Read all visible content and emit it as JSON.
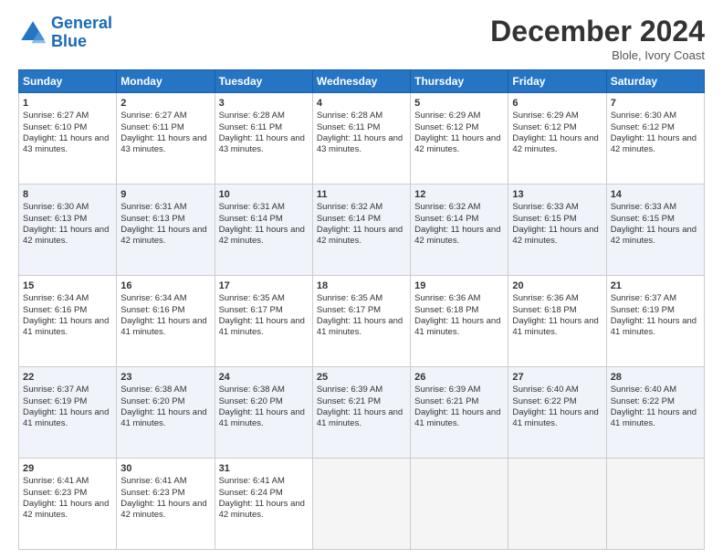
{
  "header": {
    "logo_line1": "General",
    "logo_line2": "Blue",
    "month_title": "December 2024",
    "location": "Blole, Ivory Coast"
  },
  "days_of_week": [
    "Sunday",
    "Monday",
    "Tuesday",
    "Wednesday",
    "Thursday",
    "Friday",
    "Saturday"
  ],
  "weeks": [
    [
      {
        "day": "1",
        "rise": "6:27 AM",
        "set": "6:10 PM",
        "daylight": "11 hours and 43 minutes."
      },
      {
        "day": "2",
        "rise": "6:27 AM",
        "set": "6:11 PM",
        "daylight": "11 hours and 43 minutes."
      },
      {
        "day": "3",
        "rise": "6:28 AM",
        "set": "6:11 PM",
        "daylight": "11 hours and 43 minutes."
      },
      {
        "day": "4",
        "rise": "6:28 AM",
        "set": "6:11 PM",
        "daylight": "11 hours and 43 minutes."
      },
      {
        "day": "5",
        "rise": "6:29 AM",
        "set": "6:12 PM",
        "daylight": "11 hours and 42 minutes."
      },
      {
        "day": "6",
        "rise": "6:29 AM",
        "set": "6:12 PM",
        "daylight": "11 hours and 42 minutes."
      },
      {
        "day": "7",
        "rise": "6:30 AM",
        "set": "6:12 PM",
        "daylight": "11 hours and 42 minutes."
      }
    ],
    [
      {
        "day": "8",
        "rise": "6:30 AM",
        "set": "6:13 PM",
        "daylight": "11 hours and 42 minutes."
      },
      {
        "day": "9",
        "rise": "6:31 AM",
        "set": "6:13 PM",
        "daylight": "11 hours and 42 minutes."
      },
      {
        "day": "10",
        "rise": "6:31 AM",
        "set": "6:14 PM",
        "daylight": "11 hours and 42 minutes."
      },
      {
        "day": "11",
        "rise": "6:32 AM",
        "set": "6:14 PM",
        "daylight": "11 hours and 42 minutes."
      },
      {
        "day": "12",
        "rise": "6:32 AM",
        "set": "6:14 PM",
        "daylight": "11 hours and 42 minutes."
      },
      {
        "day": "13",
        "rise": "6:33 AM",
        "set": "6:15 PM",
        "daylight": "11 hours and 42 minutes."
      },
      {
        "day": "14",
        "rise": "6:33 AM",
        "set": "6:15 PM",
        "daylight": "11 hours and 42 minutes."
      }
    ],
    [
      {
        "day": "15",
        "rise": "6:34 AM",
        "set": "6:16 PM",
        "daylight": "11 hours and 41 minutes."
      },
      {
        "day": "16",
        "rise": "6:34 AM",
        "set": "6:16 PM",
        "daylight": "11 hours and 41 minutes."
      },
      {
        "day": "17",
        "rise": "6:35 AM",
        "set": "6:17 PM",
        "daylight": "11 hours and 41 minutes."
      },
      {
        "day": "18",
        "rise": "6:35 AM",
        "set": "6:17 PM",
        "daylight": "11 hours and 41 minutes."
      },
      {
        "day": "19",
        "rise": "6:36 AM",
        "set": "6:18 PM",
        "daylight": "11 hours and 41 minutes."
      },
      {
        "day": "20",
        "rise": "6:36 AM",
        "set": "6:18 PM",
        "daylight": "11 hours and 41 minutes."
      },
      {
        "day": "21",
        "rise": "6:37 AM",
        "set": "6:19 PM",
        "daylight": "11 hours and 41 minutes."
      }
    ],
    [
      {
        "day": "22",
        "rise": "6:37 AM",
        "set": "6:19 PM",
        "daylight": "11 hours and 41 minutes."
      },
      {
        "day": "23",
        "rise": "6:38 AM",
        "set": "6:20 PM",
        "daylight": "11 hours and 41 minutes."
      },
      {
        "day": "24",
        "rise": "6:38 AM",
        "set": "6:20 PM",
        "daylight": "11 hours and 41 minutes."
      },
      {
        "day": "25",
        "rise": "6:39 AM",
        "set": "6:21 PM",
        "daylight": "11 hours and 41 minutes."
      },
      {
        "day": "26",
        "rise": "6:39 AM",
        "set": "6:21 PM",
        "daylight": "11 hours and 41 minutes."
      },
      {
        "day": "27",
        "rise": "6:40 AM",
        "set": "6:22 PM",
        "daylight": "11 hours and 41 minutes."
      },
      {
        "day": "28",
        "rise": "6:40 AM",
        "set": "6:22 PM",
        "daylight": "11 hours and 41 minutes."
      }
    ],
    [
      {
        "day": "29",
        "rise": "6:41 AM",
        "set": "6:23 PM",
        "daylight": "11 hours and 42 minutes."
      },
      {
        "day": "30",
        "rise": "6:41 AM",
        "set": "6:23 PM",
        "daylight": "11 hours and 42 minutes."
      },
      {
        "day": "31",
        "rise": "6:41 AM",
        "set": "6:24 PM",
        "daylight": "11 hours and 42 minutes."
      },
      null,
      null,
      null,
      null
    ]
  ]
}
